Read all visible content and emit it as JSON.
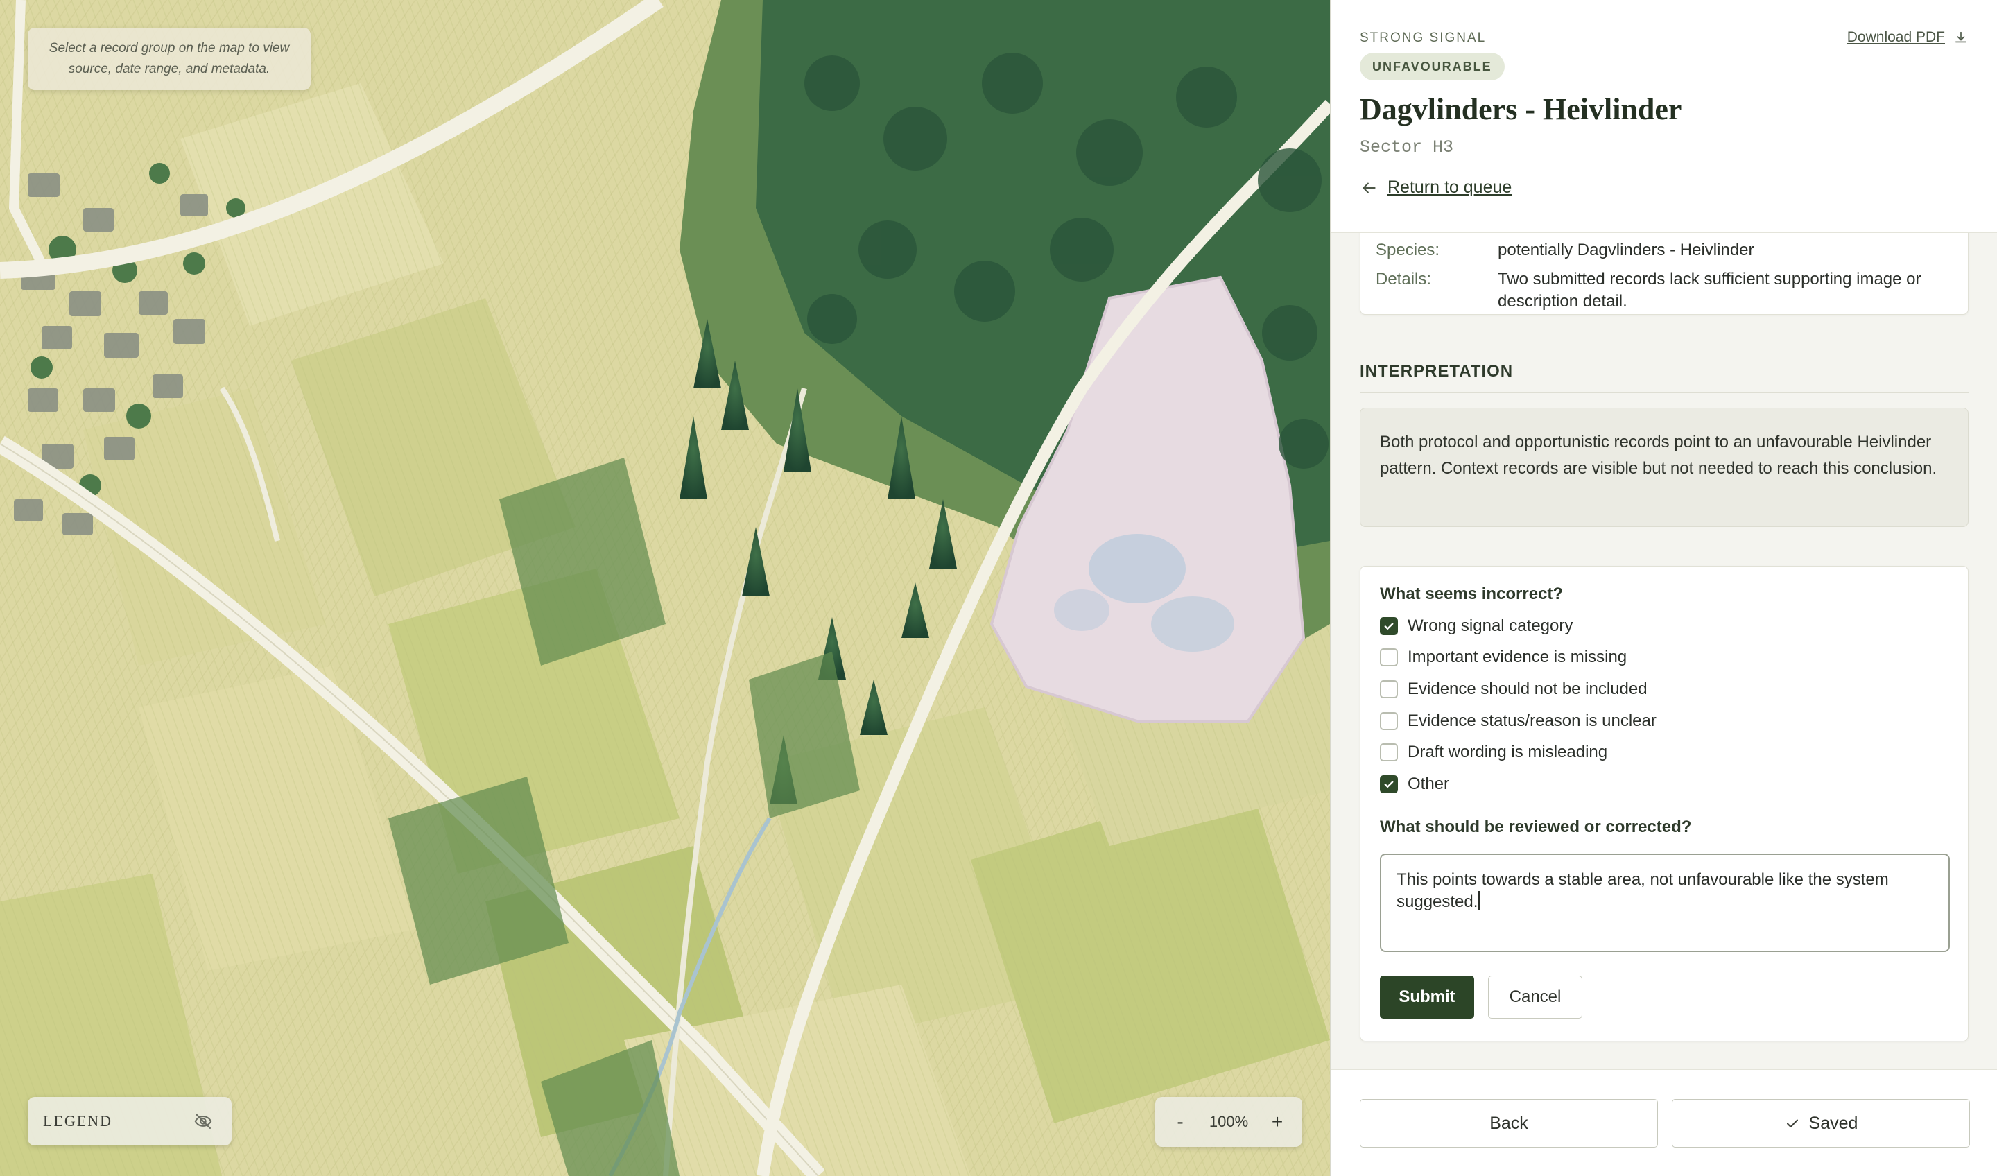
{
  "map": {
    "hint": "Select a record group on the map to view source, date range, and metadata.",
    "legend_label": "LEGEND",
    "legend_toggle_icon": "eye-off-icon",
    "zoom_out_label": "-",
    "zoom_in_label": "+",
    "zoom_level": "100%"
  },
  "header": {
    "eyebrow": "STRONG SIGNAL",
    "badge": "UNFAVOURABLE",
    "download_label": "Download PDF",
    "title": "Dagvlinders - Heivlinder",
    "subtitle": "Sector H3",
    "return_label": "Return to queue"
  },
  "meta": {
    "rows": [
      {
        "key": "Species:",
        "value": "potentially Dagvlinders - Heivlinder"
      },
      {
        "key": "Details:",
        "value": "Two submitted records lack sufficient supporting image or description detail."
      }
    ]
  },
  "interpretation": {
    "heading": "INTERPRETATION",
    "text": "Both protocol and opportunistic records point to an unfavourable Heivlinder pattern. Context records are visible but not needed to reach this conclusion."
  },
  "feedback": {
    "question": "What seems incorrect?",
    "options": [
      {
        "label": "Wrong signal category",
        "checked": true
      },
      {
        "label": "Important evidence is missing",
        "checked": false
      },
      {
        "label": "Evidence should not be included",
        "checked": false
      },
      {
        "label": "Evidence status/reason is unclear",
        "checked": false
      },
      {
        "label": "Draft wording is misleading",
        "checked": false
      },
      {
        "label": "Other",
        "checked": true
      }
    ],
    "textarea_label": "What should be reviewed or corrected?",
    "textarea_value": "This points towards a stable area, not unfavourable like the system suggested.",
    "submit_label": "Submit",
    "cancel_label": "Cancel"
  },
  "footer": {
    "back_label": "Back",
    "saved_label": "Saved"
  },
  "colors": {
    "accent": "#2c4527",
    "badge_bg": "#e4e9d9",
    "map_field": "#ddd9a4",
    "forest": "#2f5a3a",
    "heath": "#e6d8df"
  }
}
